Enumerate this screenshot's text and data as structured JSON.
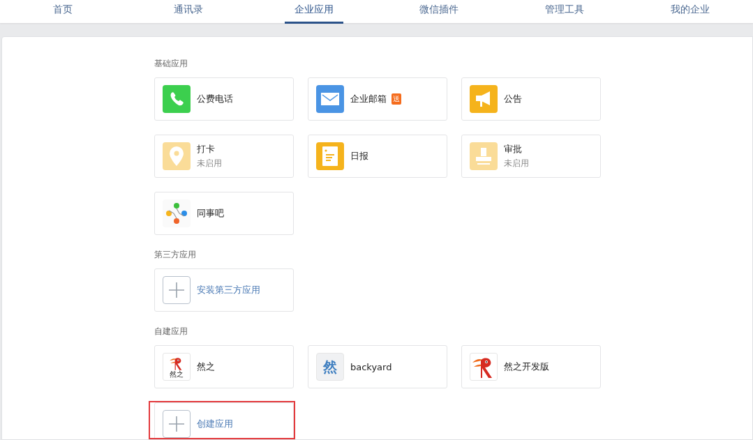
{
  "nav": [
    {
      "label": "首页",
      "selected": false
    },
    {
      "label": "通讯录",
      "selected": false
    },
    {
      "label": "企业应用",
      "selected": true
    },
    {
      "label": "微信插件",
      "selected": false
    },
    {
      "label": "管理工具",
      "selected": false
    },
    {
      "label": "我的企业",
      "selected": false
    }
  ],
  "sections": [
    {
      "title": "基础应用",
      "cards": [
        {
          "kind": "app",
          "name": "公费电话",
          "enabled": true
        },
        {
          "kind": "app",
          "name": "企业邮箱",
          "badge": "送",
          "enabled": true
        },
        {
          "kind": "app",
          "name": "公告",
          "enabled": true
        },
        {
          "kind": "app",
          "name": "打卡",
          "status": "未启用",
          "enabled": false
        },
        {
          "kind": "app",
          "name": "日报",
          "enabled": true
        },
        {
          "kind": "app",
          "name": "审批",
          "status": "未启用",
          "enabled": false
        },
        {
          "kind": "app",
          "name": "同事吧",
          "enabled": true
        }
      ]
    },
    {
      "title": "第三方应用",
      "cards": [
        {
          "kind": "add",
          "name": "安装第三方应用",
          "highlighted": false
        }
      ]
    },
    {
      "title": "自建应用",
      "cards": [
        {
          "kind": "app",
          "icon_text": "然之",
          "name": "然之",
          "enabled": true
        },
        {
          "kind": "app",
          "icon_text": "然",
          "name": "backyard",
          "enabled": true
        },
        {
          "kind": "app",
          "name": "然之开发版",
          "enabled": true
        },
        {
          "kind": "add",
          "name": "创建应用",
          "highlighted": true
        }
      ]
    }
  ]
}
